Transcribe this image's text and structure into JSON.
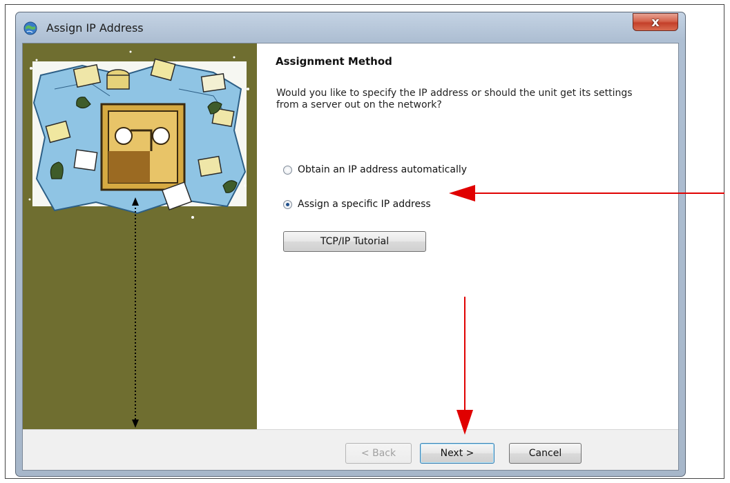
{
  "window": {
    "title": "Assign IP Address",
    "close_glyph": "x"
  },
  "page": {
    "heading": "Assignment Method",
    "description": "Would you like to specify the IP address or should the unit get its settings from a server out on the network?"
  },
  "options": [
    {
      "label": "Obtain an IP address automatically",
      "selected": false
    },
    {
      "label": "Assign a specific IP address",
      "selected": true
    }
  ],
  "buttons": {
    "tutorial": "TCP/IP Tutorial",
    "back": "< Back",
    "next": "Next >",
    "cancel": "Cancel"
  },
  "colors": {
    "left_panel": "#6f6e30",
    "annotation_arrow": "#e00000"
  },
  "icons": {
    "app": "network-globe-icon",
    "close": "close-icon"
  }
}
